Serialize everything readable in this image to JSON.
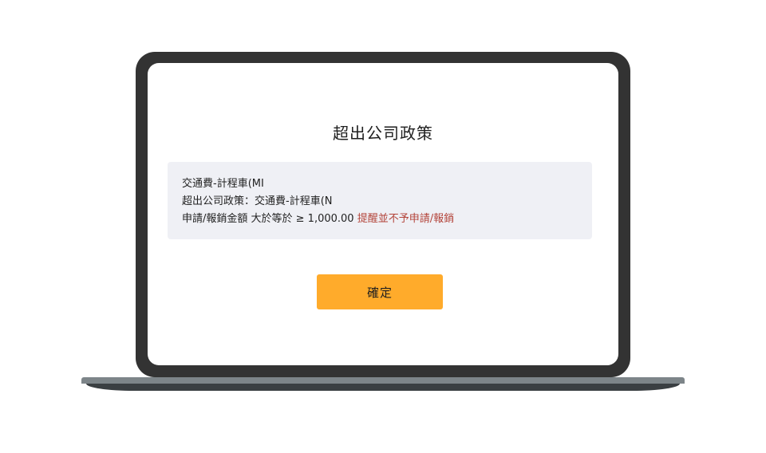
{
  "dialog": {
    "title": "超出公司政策",
    "message": {
      "line1": "交通費-計程車(MI",
      "line2": "超出公司政策：交通費-計程車(N",
      "line3_prefix": "申請/報銷金額 大於等於 ≥ 1,000.00 ",
      "line3_warning": "提醒並不予申請/報銷"
    },
    "confirm_label": "確定"
  },
  "colors": {
    "laptop_frame": "#333333",
    "message_box_bg": "#eff0f5",
    "warning_text": "#b3443a",
    "confirm_button": "#ffab2b"
  }
}
